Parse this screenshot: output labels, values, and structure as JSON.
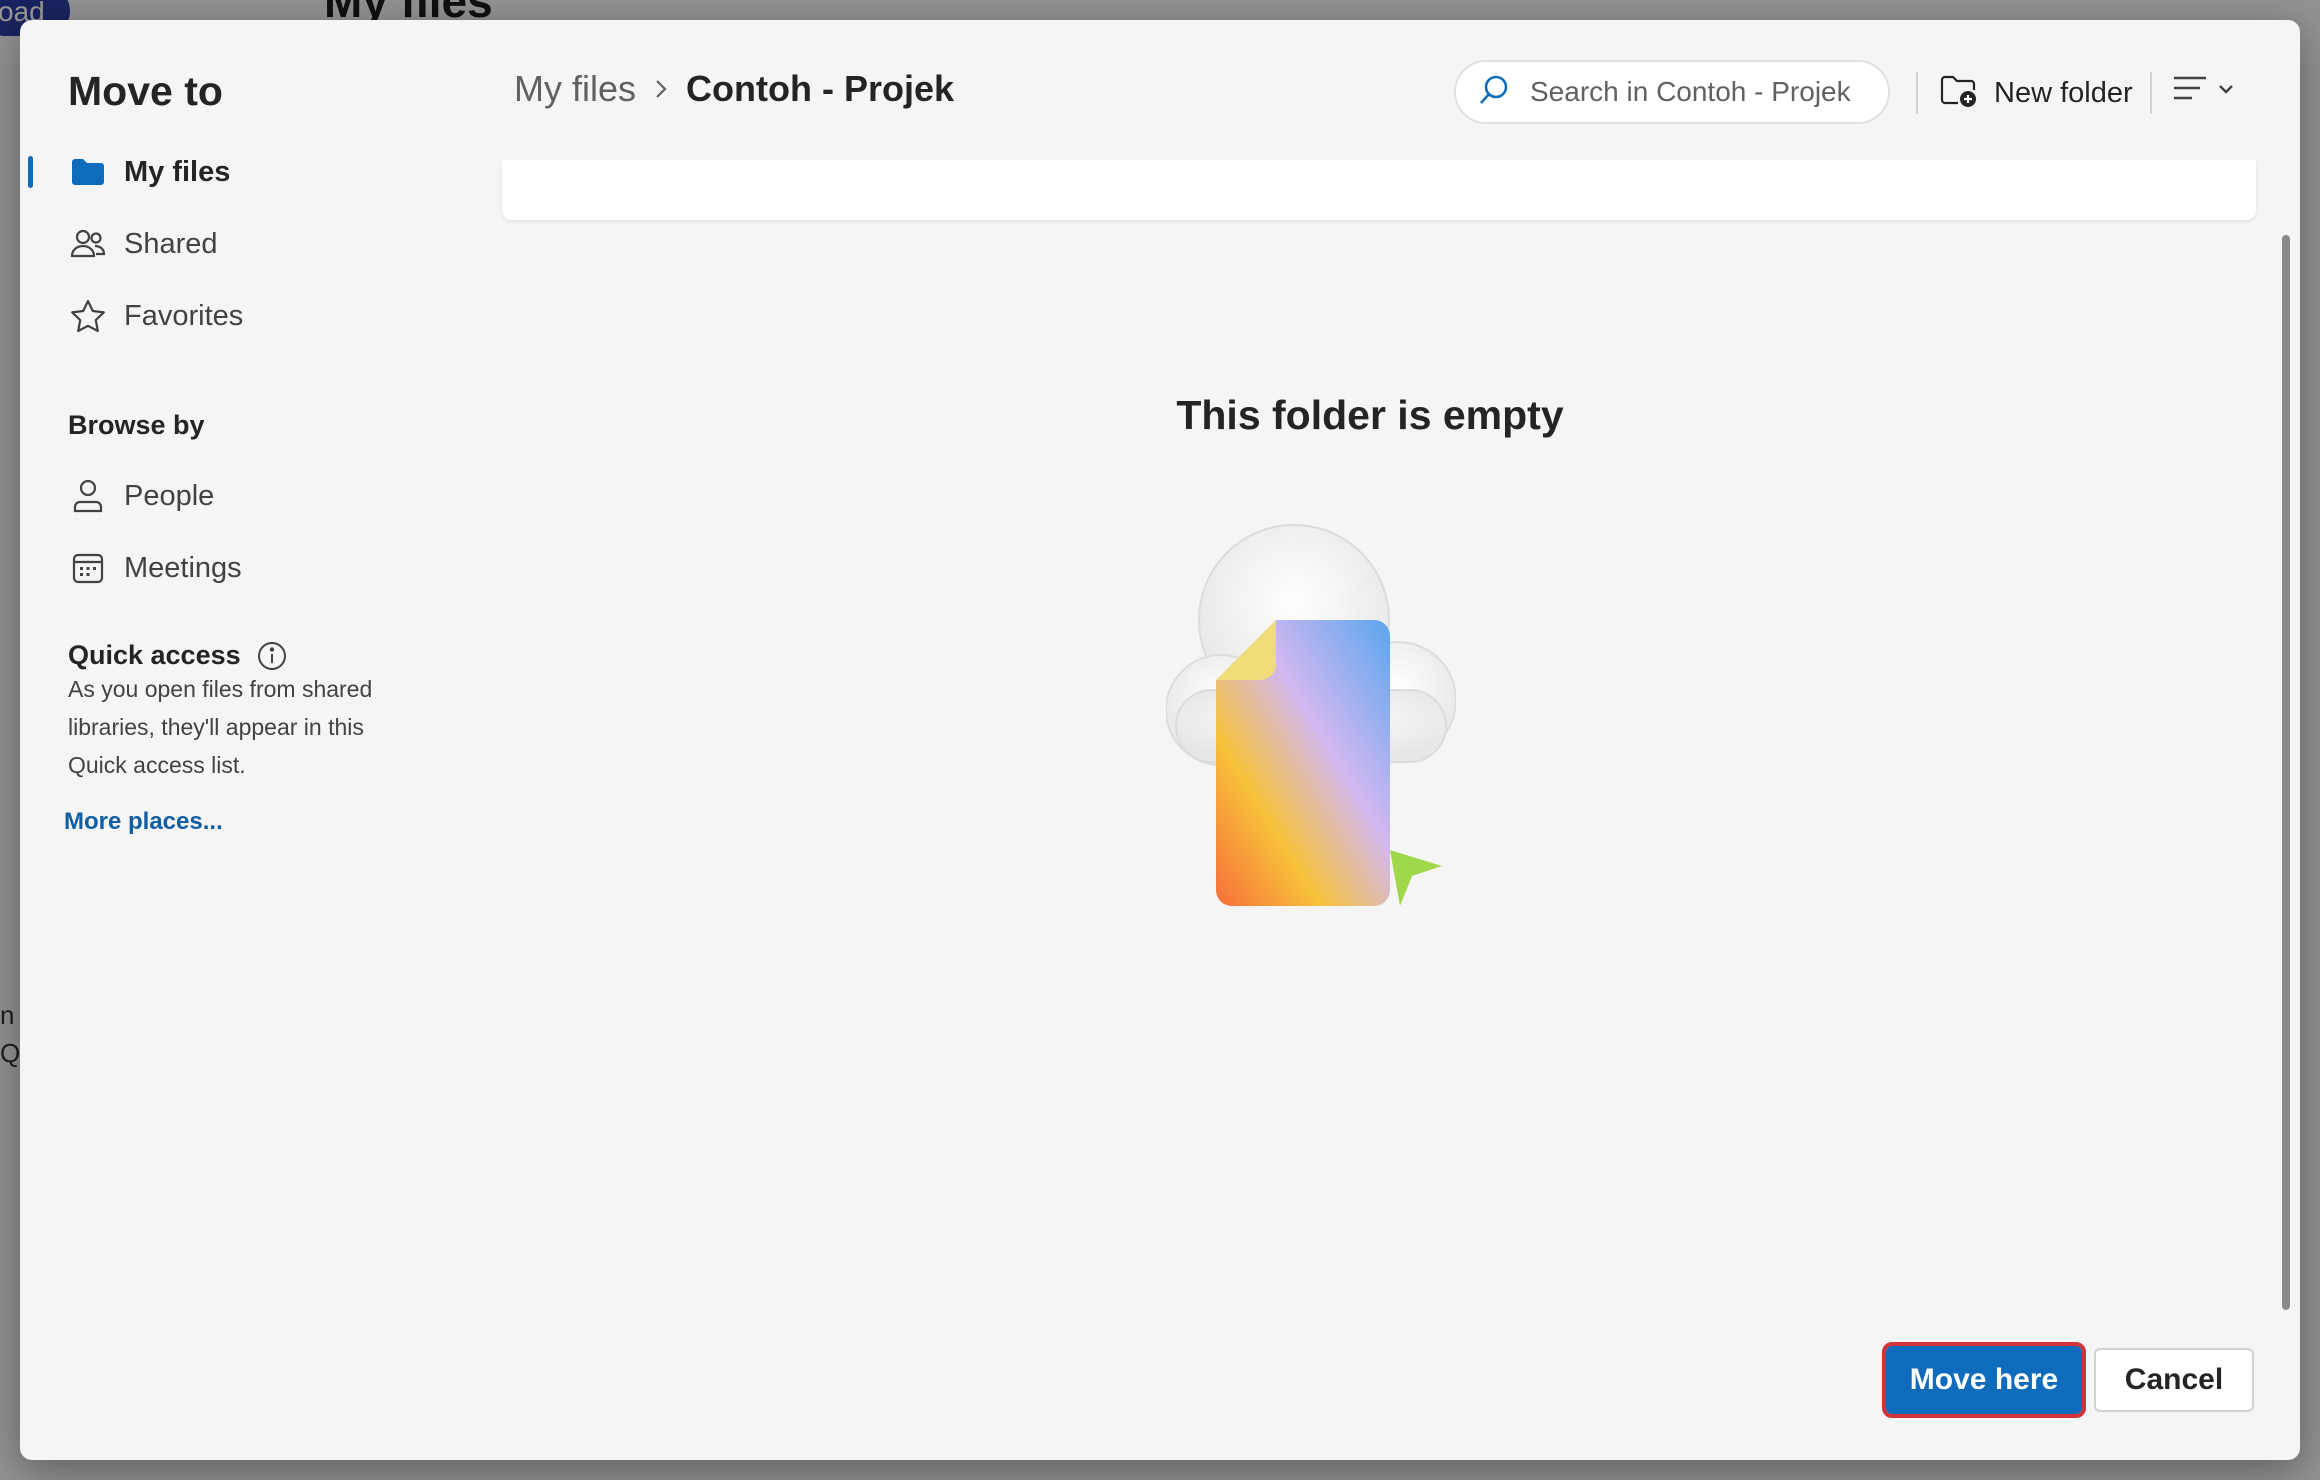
{
  "background": {
    "title": "My files",
    "pill_text": "oad",
    "side_text_1": "n s",
    "side_text_2": "Qu"
  },
  "dialog": {
    "title": "Move to"
  },
  "nav": {
    "items": [
      {
        "label": "My files",
        "icon": "folder-icon",
        "active": true
      },
      {
        "label": "Shared",
        "icon": "people-icon"
      },
      {
        "label": "Favorites",
        "icon": "star-icon"
      }
    ],
    "browse_heading": "Browse by",
    "browse_items": [
      {
        "label": "People",
        "icon": "person-icon"
      },
      {
        "label": "Meetings",
        "icon": "calendar-icon"
      }
    ],
    "quick_access_heading": "Quick access",
    "quick_access_text": "As you open files from shared libraries, they'll appear in this Quick access list.",
    "more_places": "More places..."
  },
  "header": {
    "breadcrumb_parent": "My files",
    "breadcrumb_current": "Contoh - Projek",
    "search_placeholder": "Search in Contoh - Projek",
    "new_folder_label": "New folder"
  },
  "content": {
    "empty_title": "This folder is empty"
  },
  "footer": {
    "primary_label": "Move here",
    "secondary_label": "Cancel"
  },
  "colors": {
    "accent": "#0f6cbd",
    "focus_ring": "#d13438"
  }
}
